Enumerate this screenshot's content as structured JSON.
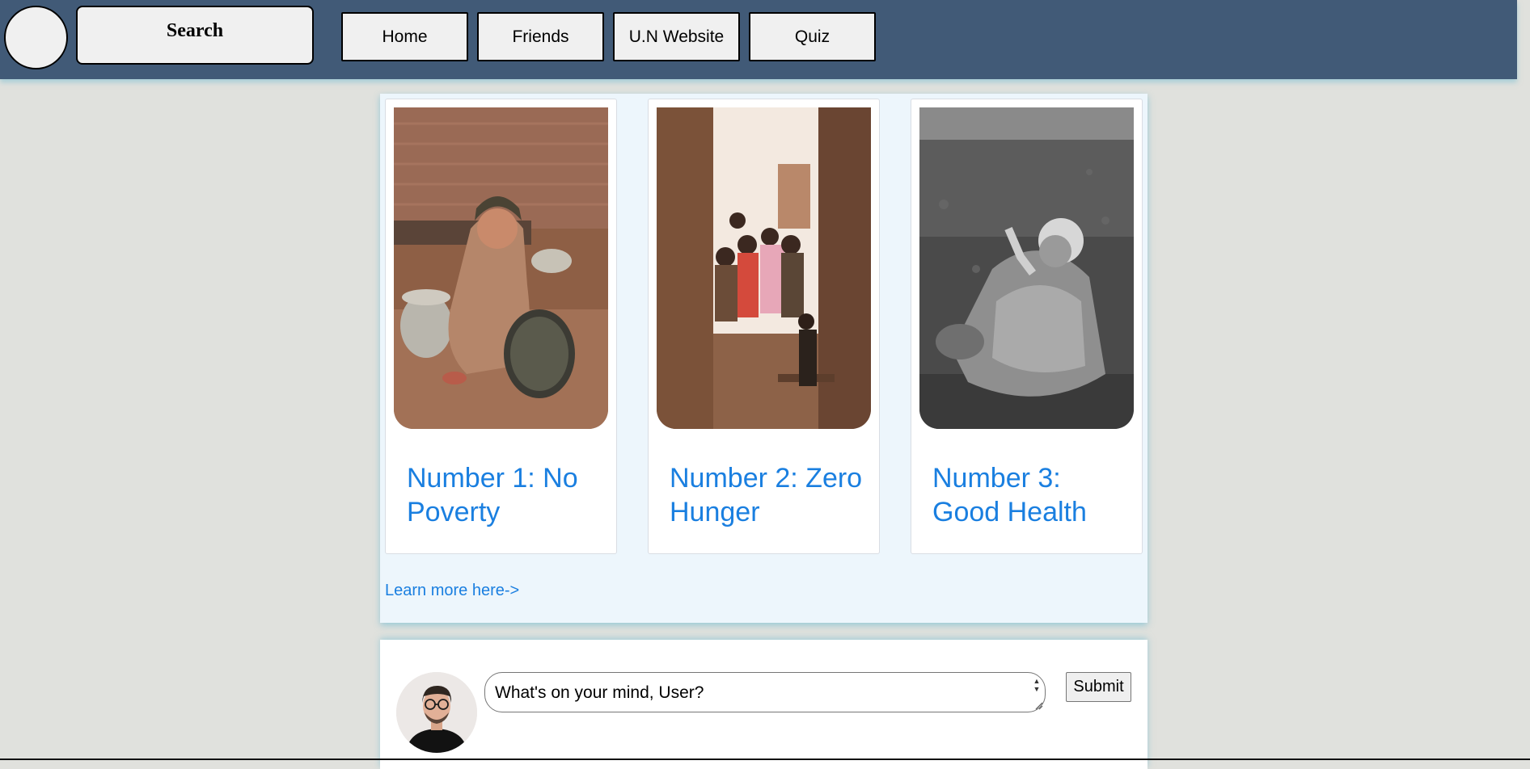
{
  "header": {
    "search_label": "Search",
    "nav": [
      {
        "label": "Home"
      },
      {
        "label": "Friends"
      },
      {
        "label": "U.N Website"
      },
      {
        "label": "Quiz"
      }
    ]
  },
  "goals": {
    "cards": [
      {
        "title": "Number 1: No Poverty",
        "image": "child-with-pot-photo"
      },
      {
        "title": "Number 2: Zero Hunger",
        "image": "children-in-doorway-photo"
      },
      {
        "title": "Number 3: Good Health",
        "image": "elderly-woman-bw-photo"
      }
    ],
    "learn_more": "Learn more here->"
  },
  "composer": {
    "placeholder": "What's on your mind, User?",
    "submit_label": "Submit"
  },
  "colors": {
    "topbar": "#415a77",
    "background": "#e0e1dd",
    "panel": "#edf6fc",
    "link": "#1a7fe0"
  }
}
